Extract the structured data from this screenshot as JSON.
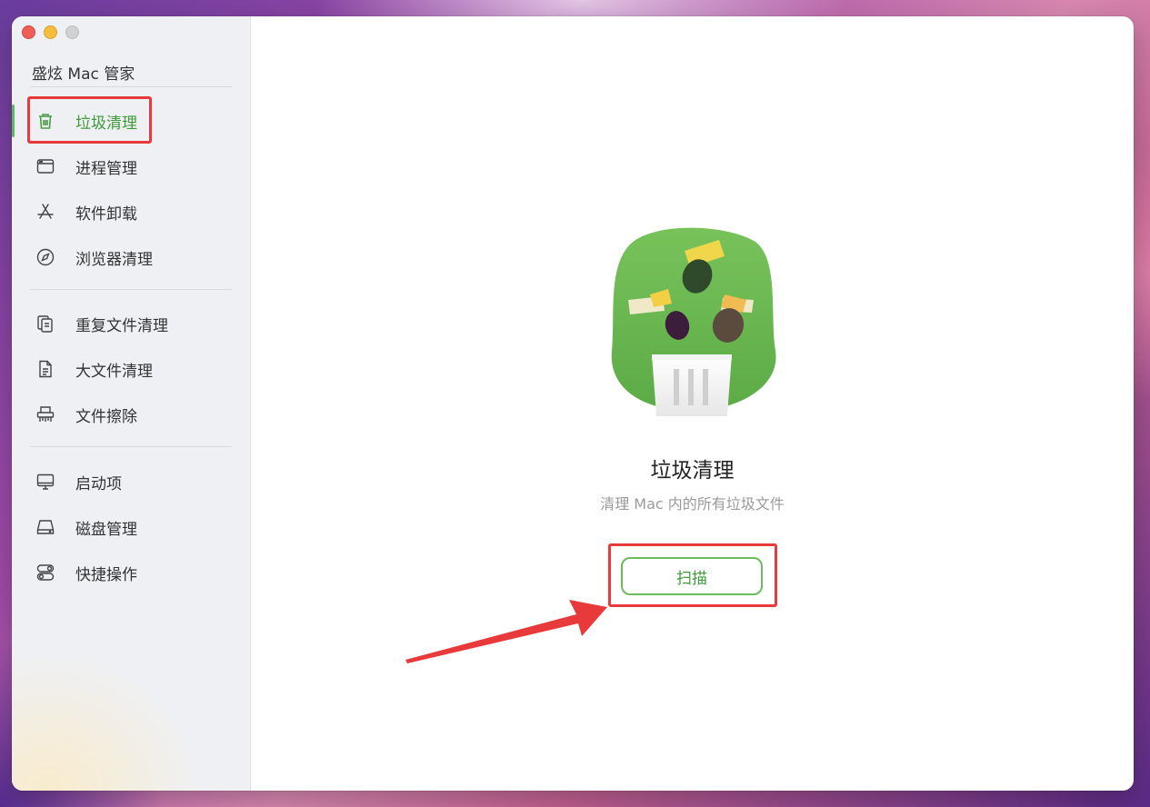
{
  "app": {
    "title": "盛炫 Mac 管家"
  },
  "sidebar": {
    "groups": [
      {
        "items": [
          {
            "label": "垃圾清理",
            "icon": "trash-icon",
            "active": true
          },
          {
            "label": "进程管理",
            "icon": "window-icon"
          },
          {
            "label": "软件卸载",
            "icon": "app-store-icon"
          },
          {
            "label": "浏览器清理",
            "icon": "compass-icon"
          }
        ]
      },
      {
        "items": [
          {
            "label": "重复文件清理",
            "icon": "duplicate-files-icon"
          },
          {
            "label": "大文件清理",
            "icon": "document-icon"
          },
          {
            "label": "文件擦除",
            "icon": "shredder-icon"
          }
        ]
      },
      {
        "items": [
          {
            "label": "启动项",
            "icon": "monitor-icon"
          },
          {
            "label": "磁盘管理",
            "icon": "disk-icon"
          },
          {
            "label": "快捷操作",
            "icon": "toggles-icon"
          }
        ]
      }
    ]
  },
  "main": {
    "title": "垃圾清理",
    "subtitle": "清理 Mac 内的所有垃圾文件",
    "scan_button": "扫描",
    "illustration": "trash-bin-illustration"
  },
  "colors": {
    "accent": "#5cb85c",
    "highlight": "#e83a3a"
  }
}
